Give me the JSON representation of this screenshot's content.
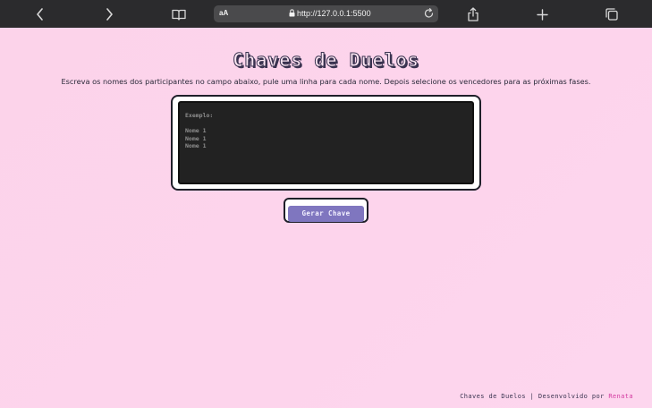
{
  "browser": {
    "text_size_label": "aA",
    "url": "http://127.0.0.1:5500",
    "icons": {
      "back": "chevron-left-icon",
      "forward": "chevron-right-icon",
      "reader": "book-icon",
      "lock": "lock-icon",
      "reload": "reload-icon",
      "share": "share-icon",
      "new_tab": "plus-icon",
      "tabs": "tabs-icon"
    }
  },
  "page": {
    "title": "Chaves de Duelos",
    "instructions": "Escreva os nomes dos participantes no campo abaixo, pule uma linha para cada nome. Depois selecione os vencedores para as próximas fases.",
    "textarea_placeholder": "Exemplo:\n\nNome 1\nNome 1\nNome 1",
    "generate_button": "Gerar Chave"
  },
  "footer": {
    "text": "Chaves de Duelos | Desenvolvido por ",
    "author": "Renata"
  },
  "colors": {
    "background": "#fdd4ec",
    "button": "#7f76bf",
    "textarea_bg": "#222222",
    "author_link": "#d33aa0"
  }
}
